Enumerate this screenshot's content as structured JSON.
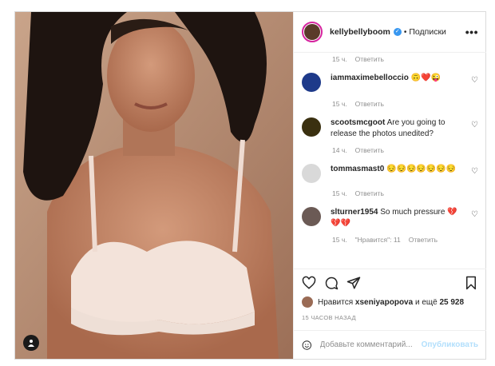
{
  "header": {
    "username": "kellybellyboom",
    "separator": "•",
    "follow_label": "Подписки",
    "more_label": "•••"
  },
  "comments": {
    "top_meta": {
      "time": "15 ч.",
      "reply": "Ответить"
    },
    "items": [
      {
        "user": "iammaximebelloccio",
        "text": "🙃❤️😜",
        "time": "15 ч.",
        "reply": "Ответить",
        "avatar_color": "#1e3a8a"
      },
      {
        "user": "scootsmcgoot",
        "text": "Are you going to release the photos unedited?",
        "time": "14 ч.",
        "reply": "Ответить",
        "avatar_color": "#3a3010"
      },
      {
        "user": "tommasmast0",
        "text": "😔😔😔😔😔😔😔",
        "time": "15 ч.",
        "reply": "Ответить",
        "avatar_color": "#d9d9d9"
      },
      {
        "user": "slturner1954",
        "text": "So much pressure 💔💔💔",
        "time": "15 ч.",
        "likes": "\"Нравится\": 11",
        "reply": "Ответить",
        "avatar_color": "#6b5a55"
      }
    ]
  },
  "likes": {
    "prefix": "Нравится",
    "user": "xseniyapopova",
    "middle": "и ещё",
    "count": "25 928"
  },
  "timestamp": "15 ЧАСОВ НАЗАД",
  "add_comment": {
    "placeholder": "Добавьте комментарий...",
    "publish_label": "Опубликовать"
  },
  "icons": {
    "heart": "heart-icon",
    "comment": "comment-icon",
    "share": "share-icon",
    "save": "bookmark-icon",
    "emoji": "emoji-icon",
    "tag": "user-tag-icon",
    "verified": "verified-icon"
  },
  "colors": {
    "verified": "#3897f0",
    "publish": "#b2dffc",
    "story_ring": "#d6249f"
  }
}
